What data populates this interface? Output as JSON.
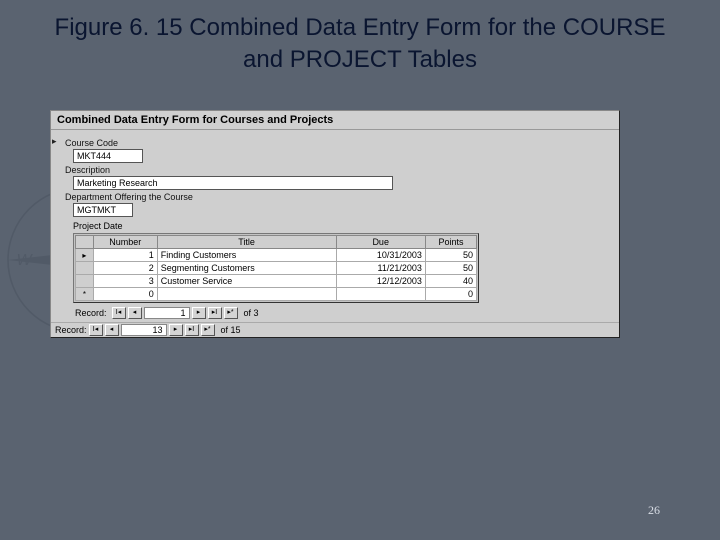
{
  "slide": {
    "title": "Figure 6. 15 Combined Data Entry Form for the COURSE and PROJECT Tables",
    "page_number": "26"
  },
  "form": {
    "header": "Combined Data Entry Form for Courses and Projects",
    "course_code_label": "Course Code",
    "course_code_value": "MKT444",
    "description_label": "Description",
    "description_value": "Marketing Research",
    "department_label": "Department Offering the Course",
    "department_value": "MGTMKT",
    "subform_title": "Project Date",
    "columns": {
      "number": "Number",
      "title": "Title",
      "due": "Due",
      "points": "Points"
    },
    "rows": [
      {
        "marker": "▸",
        "number": "1",
        "title": "Finding Customers",
        "due": "10/31/2003",
        "points": "50"
      },
      {
        "marker": "",
        "number": "2",
        "title": "Segmenting Customers",
        "due": "11/21/2003",
        "points": "50"
      },
      {
        "marker": "",
        "number": "3",
        "title": "Customer Service",
        "due": "12/12/2003",
        "points": "40"
      }
    ],
    "newrow": {
      "marker": "*",
      "number": "0",
      "title": "",
      "due": "",
      "points": "0"
    },
    "inner_nav": {
      "label": "Record:",
      "pos": "1",
      "total": "of  3"
    },
    "outer_nav": {
      "label": "Record:",
      "pos": "13",
      "total": "of  15"
    },
    "nav_icons": {
      "first": "I◂",
      "prev": "◂",
      "next": "▸",
      "last": "▸I",
      "new": "▸*"
    }
  }
}
